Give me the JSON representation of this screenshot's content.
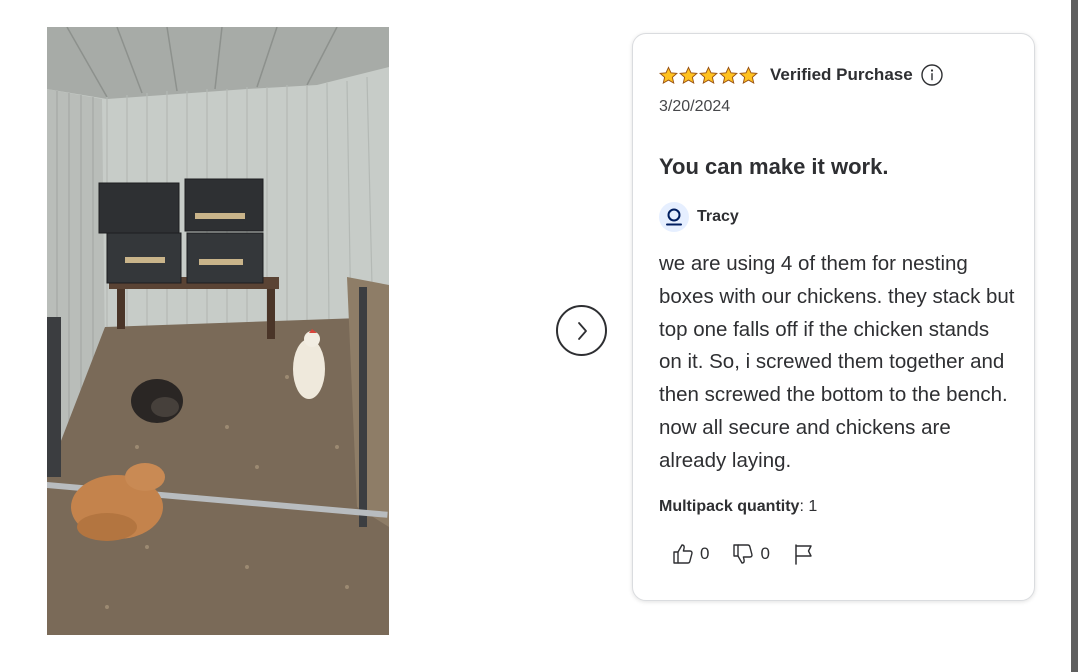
{
  "photo": {
    "alt": ""
  },
  "carousel": {
    "next_label": ""
  },
  "review": {
    "rating": 5,
    "rating_max": 5,
    "verified_label": "Verified Purchase",
    "date": "3/20/2024",
    "title": "You can make it work.",
    "author": "Tracy",
    "body": "we are using 4 of them for nesting boxes with our chickens. they stack but top one falls off if the chicken stands on it. So, i screwed them together and then screwed the bottom to the bench. now all secure and chickens are already laying.",
    "attribute": {
      "label": "Multipack quantity",
      "separator": ": ",
      "value": "1"
    },
    "helpful_count": "0",
    "not_helpful_count": "0"
  },
  "colors": {
    "star": "#ffc220",
    "star_outline": "#995213",
    "text": "#2e2f32",
    "avatar_bg": "#e6efff",
    "avatar_icon": "#001e60"
  },
  "icons": {
    "star": "star-icon",
    "info": "info-icon",
    "user": "user-icon",
    "thumbs_up": "thumbs-up-icon",
    "thumbs_down": "thumbs-down-icon",
    "flag": "flag-icon",
    "next": "chevron-right-icon"
  }
}
